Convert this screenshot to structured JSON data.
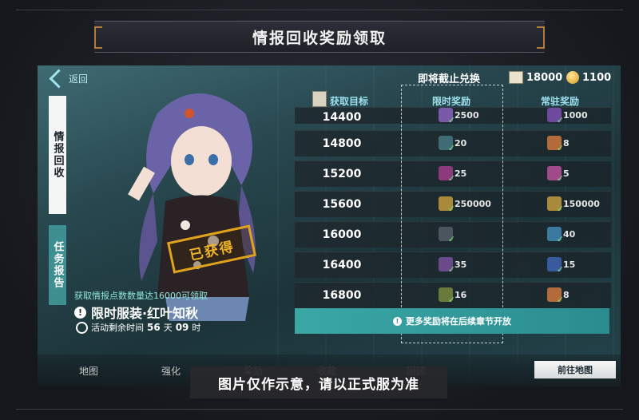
{
  "window": {
    "title": "情报回收奖励领取"
  },
  "nav": {
    "back_label": "返回"
  },
  "side_tabs": [
    {
      "label": "情报回收",
      "active": true
    },
    {
      "label": "任务报告",
      "active": false
    }
  ],
  "header": {
    "exchange_label": "即将截止兑换",
    "ticket_amount": "18000",
    "gold_amount": "1100",
    "col_target": "获取目标",
    "col_limited": "限时奖励",
    "col_permanent": "常驻奖励"
  },
  "character_panel": {
    "stamp": "已获得",
    "requirement": "获取情报点数数量达16000可领取",
    "outfit_name": "限时服装·红叶知秋",
    "remaining_label": "活动剩余时间",
    "days": "56",
    "days_unit": "天",
    "hours": "09",
    "hours_unit": "时"
  },
  "reward_rows": [
    {
      "target": "14400",
      "limited": "2500",
      "permanent": "1000",
      "limited_color": "#7a5aa8",
      "permanent_color": "#6d4aa0"
    },
    {
      "target": "14800",
      "limited": "20",
      "permanent": "8",
      "limited_color": "#3f6b74",
      "permanent_color": "#b36b3a"
    },
    {
      "target": "15200",
      "limited": "25",
      "permanent": "5",
      "limited_color": "#8a3a7a",
      "permanent_color": "#a04a8a"
    },
    {
      "target": "15600",
      "limited": "250000",
      "permanent": "150000",
      "limited_color": "#a88a3a",
      "permanent_color": "#a88a3a"
    },
    {
      "target": "16000",
      "limited": "",
      "permanent": "40",
      "limited_color": "#4a5560",
      "permanent_color": "#3a7aa0"
    },
    {
      "target": "16400",
      "limited": "35",
      "permanent": "15",
      "limited_color": "#6a4a8a",
      "permanent_color": "#3a5aa0"
    },
    {
      "target": "16800",
      "limited": "16",
      "permanent": "8",
      "limited_color": "#6a7a3a",
      "permanent_color": "#b36b3a"
    }
  ],
  "notice": "更多奖励将在后续章节开放",
  "bottom_nav": [
    "地图",
    "强化",
    "奖励",
    "收藏",
    "回顾"
  ],
  "goto_map_label": "前往地图",
  "disclaimer": "图片仅作示意，请以正式服为准"
}
